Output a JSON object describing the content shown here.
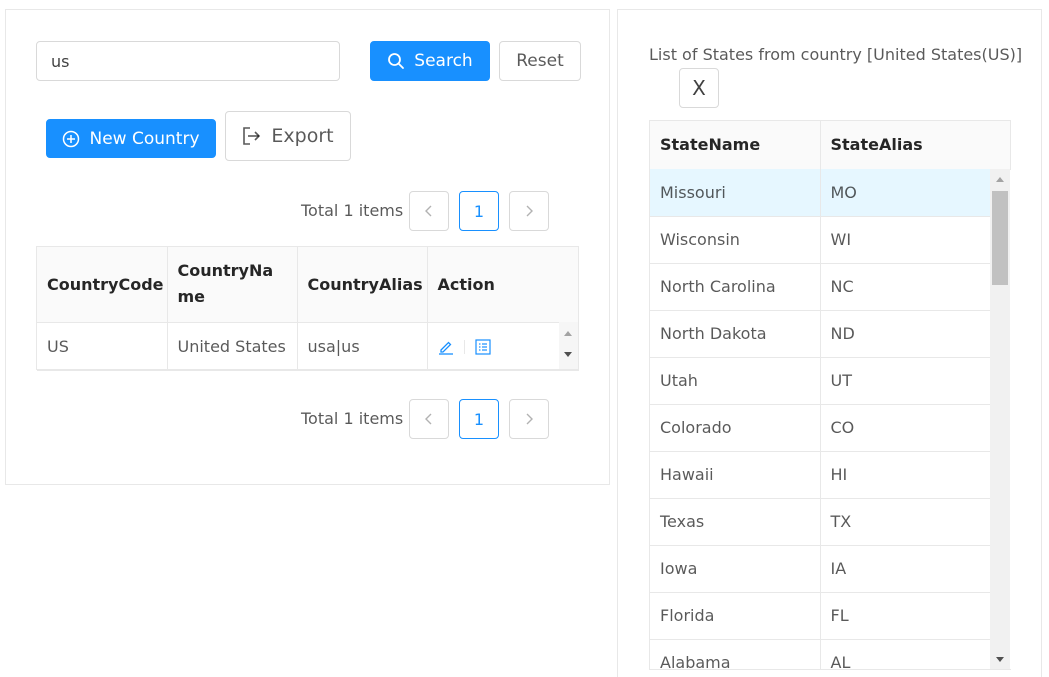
{
  "search": {
    "value": "us",
    "search_label": "Search",
    "reset_label": "Reset"
  },
  "toolbar": {
    "new_country_label": "New Country",
    "export_label": "Export"
  },
  "pagination_top": {
    "total_text": "Total 1 items",
    "current_page": "1"
  },
  "pagination_bottom": {
    "total_text": "Total 1 items",
    "current_page": "1"
  },
  "country_table": {
    "headers": [
      "CountryCode",
      "CountryName",
      "CountryAlias",
      "Action"
    ],
    "rows": [
      {
        "code": "US",
        "name": "United States",
        "alias": "usa|us"
      }
    ]
  },
  "states_panel": {
    "title": "List of States from country [United States(US)]",
    "close_label": "X",
    "headers": [
      "StateName",
      "StateAlias"
    ],
    "rows": [
      {
        "name": "Missouri",
        "alias": "MO"
      },
      {
        "name": "Wisconsin",
        "alias": "WI"
      },
      {
        "name": "North Carolina",
        "alias": "NC"
      },
      {
        "name": "North Dakota",
        "alias": "ND"
      },
      {
        "name": "Utah",
        "alias": "UT"
      },
      {
        "name": "Colorado",
        "alias": "CO"
      },
      {
        "name": "Hawaii",
        "alias": "HI"
      },
      {
        "name": "Texas",
        "alias": "TX"
      },
      {
        "name": "Iowa",
        "alias": "IA"
      },
      {
        "name": "Florida",
        "alias": "FL"
      },
      {
        "name": "Alabama",
        "alias": "AL"
      }
    ]
  },
  "colors": {
    "primary": "#1890ff",
    "row_highlight": "#e6f7ff",
    "border": "#d9d9d9"
  }
}
